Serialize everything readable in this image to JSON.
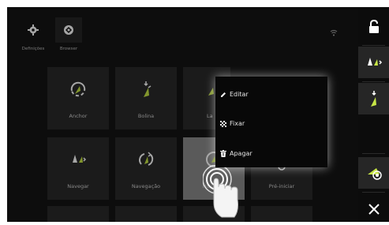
{
  "top_buttons": [
    {
      "label": "Definições",
      "icon": "gear-icon"
    },
    {
      "label": "Browser",
      "icon": "browser-icon"
    }
  ],
  "tiles": [
    {
      "label": "Anchor",
      "icon": "anchor-icon"
    },
    {
      "label": "Bolina",
      "icon": "sail-down-icon"
    },
    {
      "label": "La",
      "icon": "sail-icon"
    },
    {
      "label": "Navegar",
      "icon": "navigate-icon"
    },
    {
      "label": "Navegação",
      "icon": "navigation-icon"
    },
    {
      "label": "Nova ... i",
      "icon": "new-icon"
    },
    {
      "label": "Pré-iniciar",
      "icon": "prestart-icon"
    }
  ],
  "context_menu": [
    {
      "label": "Editar",
      "icon": "pencil-icon"
    },
    {
      "label": "Fixar",
      "icon": "pin-icon"
    },
    {
      "label": "Apagar",
      "icon": "trash-icon"
    }
  ],
  "colors": {
    "accent": "#c8e646",
    "tile": "#2a2a2a",
    "menu_bg": "#080808"
  }
}
